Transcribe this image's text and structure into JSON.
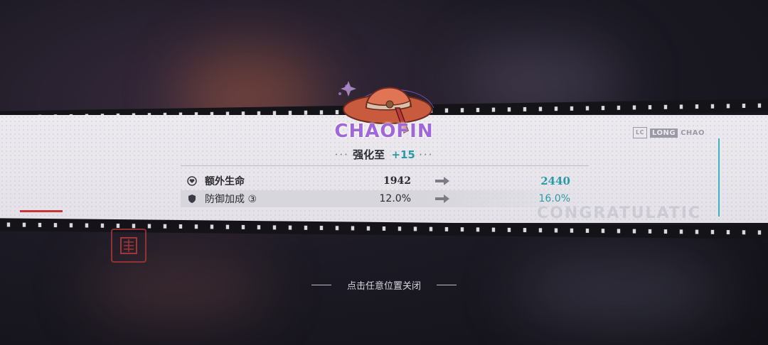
{
  "item": {
    "name": "CHAOFIN",
    "upgrade_label": "强化至",
    "upgrade_level": "+15",
    "dots": "···"
  },
  "stats": [
    {
      "name": "额外生命",
      "old": "1942",
      "new": "2440",
      "icon": "heart-shield-icon"
    },
    {
      "name": "防御加成 ③",
      "old": "12.0%",
      "new": "16.0%",
      "icon": "shield-icon"
    }
  ],
  "brand": {
    "mark": "LC",
    "left": "LONG",
    "right": "CHAO"
  },
  "watermark": "CONGRATULATIC",
  "close_hint": "点击任意位置关闭",
  "colors": {
    "accent_cyan": "#2a9aa6",
    "title_purple": "#a067d8",
    "banner": "#eceaef"
  }
}
